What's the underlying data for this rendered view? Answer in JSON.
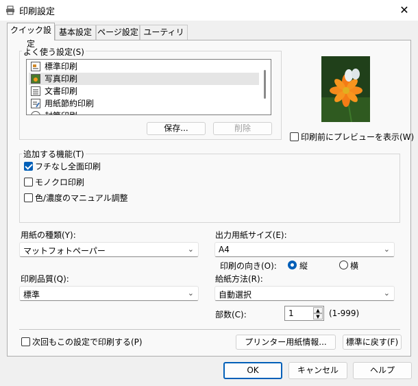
{
  "window": {
    "title": "印刷設定",
    "close_symbol": "✕"
  },
  "tabs": [
    {
      "label": "クイック設定",
      "active": true
    },
    {
      "label": "基本設定",
      "active": false
    },
    {
      "label": "ページ設定",
      "active": false
    },
    {
      "label": "ユーティリティ",
      "active": false
    }
  ],
  "favorites": {
    "label": "よく使う設定(S)",
    "items": [
      {
        "label": "標準印刷",
        "icon": "standard-print-icon"
      },
      {
        "label": "写真印刷",
        "icon": "photo-print-icon",
        "selected": true
      },
      {
        "label": "文書印刷",
        "icon": "document-print-icon"
      },
      {
        "label": "用紙節約印刷",
        "icon": "paper-saving-icon"
      },
      {
        "label": "封筒印刷",
        "icon": "envelope-icon"
      }
    ],
    "save_button": "保存...",
    "delete_button": "削除"
  },
  "preview_checkbox": {
    "label": "印刷前にプレビューを表示(W)",
    "checked": false
  },
  "features": {
    "label": "追加する機能(T)",
    "items": [
      {
        "label": "フチなし全面印刷",
        "checked": true
      },
      {
        "label": "モノクロ印刷",
        "checked": false
      },
      {
        "label": "色/濃度のマニュアル調整",
        "checked": false
      }
    ]
  },
  "media_type": {
    "label": "用紙の種類(Y):",
    "value": "マットフォトペーパー"
  },
  "output_size": {
    "label": "出力用紙サイズ(E):",
    "value": "A4"
  },
  "orientation": {
    "label": "印刷の向き(O):",
    "portrait": "縦",
    "landscape": "横",
    "selected": "portrait"
  },
  "quality": {
    "label": "印刷品質(Q):",
    "value": "標準"
  },
  "paper_source": {
    "label": "給紙方法(R):",
    "value": "自動選択"
  },
  "copies": {
    "label": "部数(C):",
    "value": "1",
    "range": "(1-999)"
  },
  "always_print_checkbox": {
    "label": "次回もこの設定で印刷する(P)",
    "checked": false
  },
  "printer_media_info_button": "プリンター用紙情報...",
  "defaults_button": "標準に戻す(F)",
  "dialog_buttons": {
    "ok": "OK",
    "cancel": "キャンセル",
    "help": "ヘルプ"
  },
  "colors": {
    "accent": "#005fb8",
    "window": "#f0f0f0",
    "panel": "#f9f9f9"
  }
}
